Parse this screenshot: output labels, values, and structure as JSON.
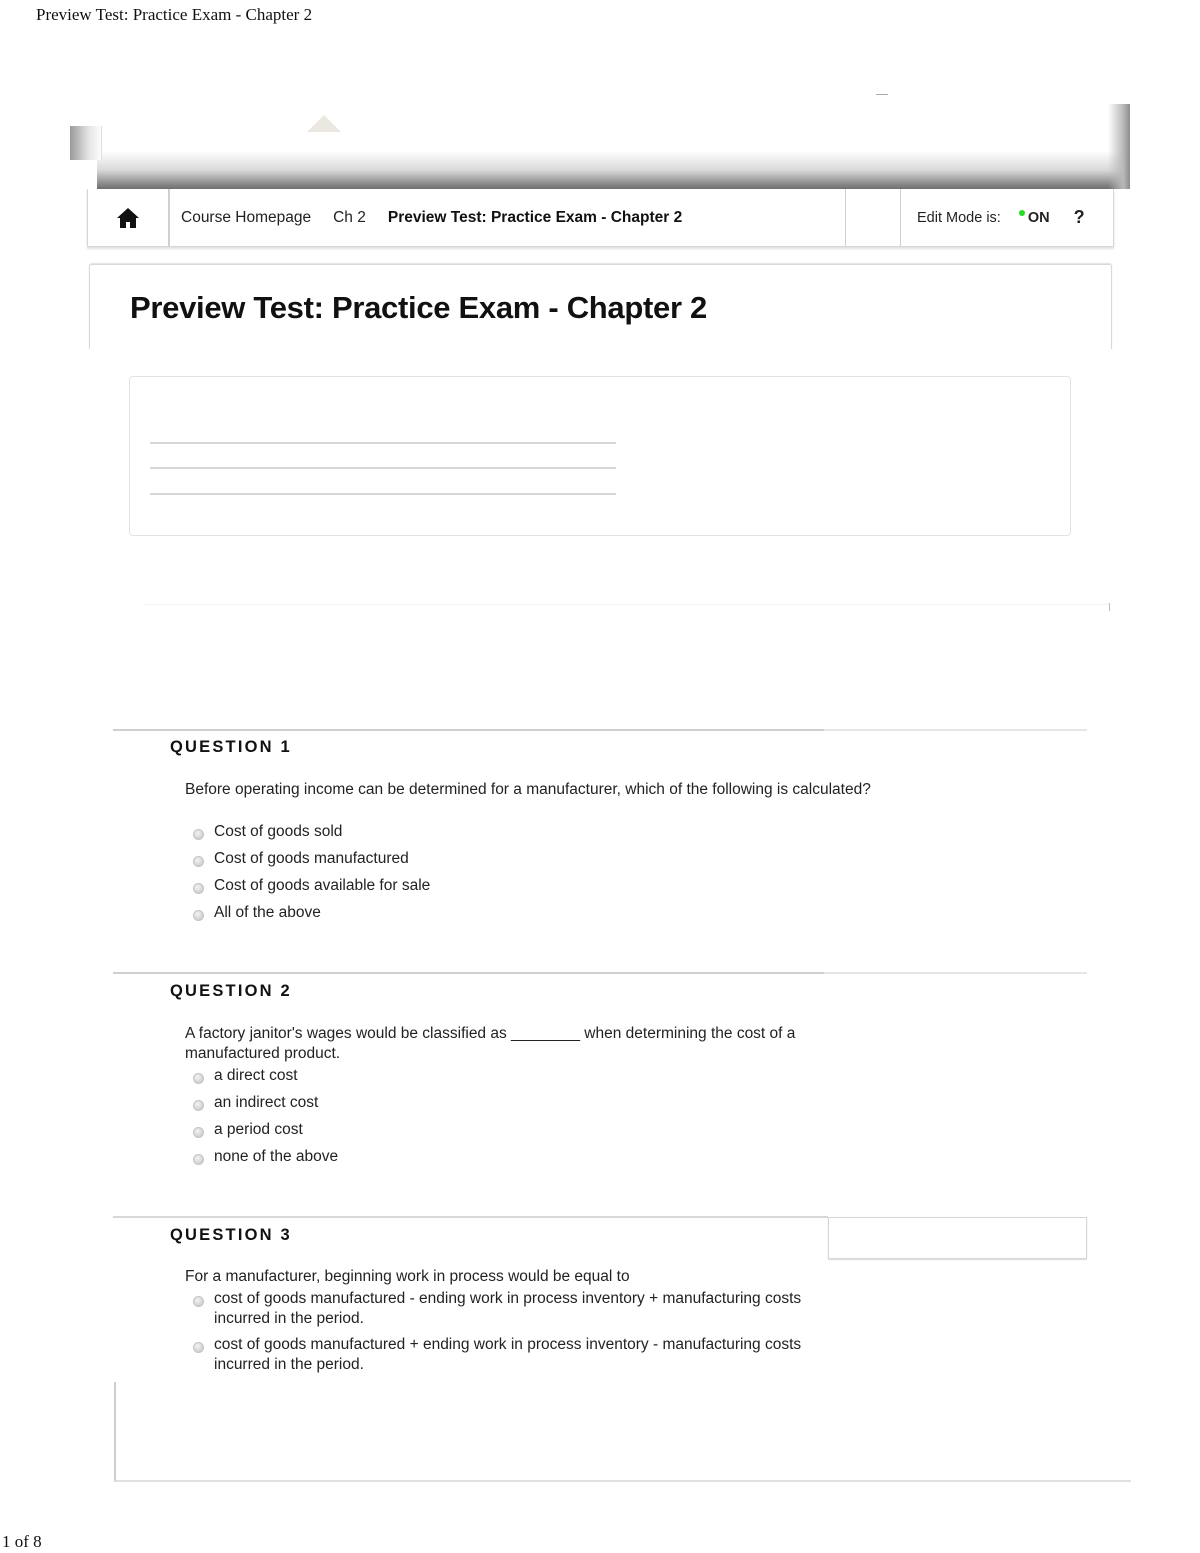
{
  "print_header": {
    "title": "Preview Test: Practice Exam - Chapter 2"
  },
  "print_footer": {
    "page_count": "1 of 8"
  },
  "nav": {
    "home_icon": "home-icon",
    "breadcrumbs": [
      {
        "label": "Course Homepage"
      },
      {
        "label": "Ch 2"
      },
      {
        "label": "Preview Test: Practice Exam - Chapter 2",
        "current": true
      }
    ],
    "edit_mode_label": "Edit Mode is:",
    "edit_mode_value": "ON",
    "edit_mode_color": "#22dd22",
    "help_label": "?"
  },
  "page": {
    "title": "Preview Test: Practice Exam - Chapter 2"
  },
  "questions": [
    {
      "heading": "QUESTION 1",
      "text": "Before operating income can be determined for a manufacturer, which of the following is calculated?",
      "options": [
        "Cost of goods sold",
        "Cost of goods manufactured",
        "Cost of goods available for sale",
        "All of the above"
      ]
    },
    {
      "heading": "QUESTION 2",
      "text": "A factory janitor's wages would be classified as ________ when determining the cost of a manufactured product.",
      "options": [
        "a direct cost",
        "an indirect cost",
        "a period cost",
        "none of the above"
      ]
    },
    {
      "heading": "QUESTION 3",
      "text": "For a manufacturer, beginning work in process would be equal to",
      "options": [
        "cost of goods manufactured - ending work in process inventory + manufacturing costs incurred in the period.",
        "cost of goods manufactured + ending work in process inventory - manufacturing costs incurred in the period."
      ]
    }
  ]
}
